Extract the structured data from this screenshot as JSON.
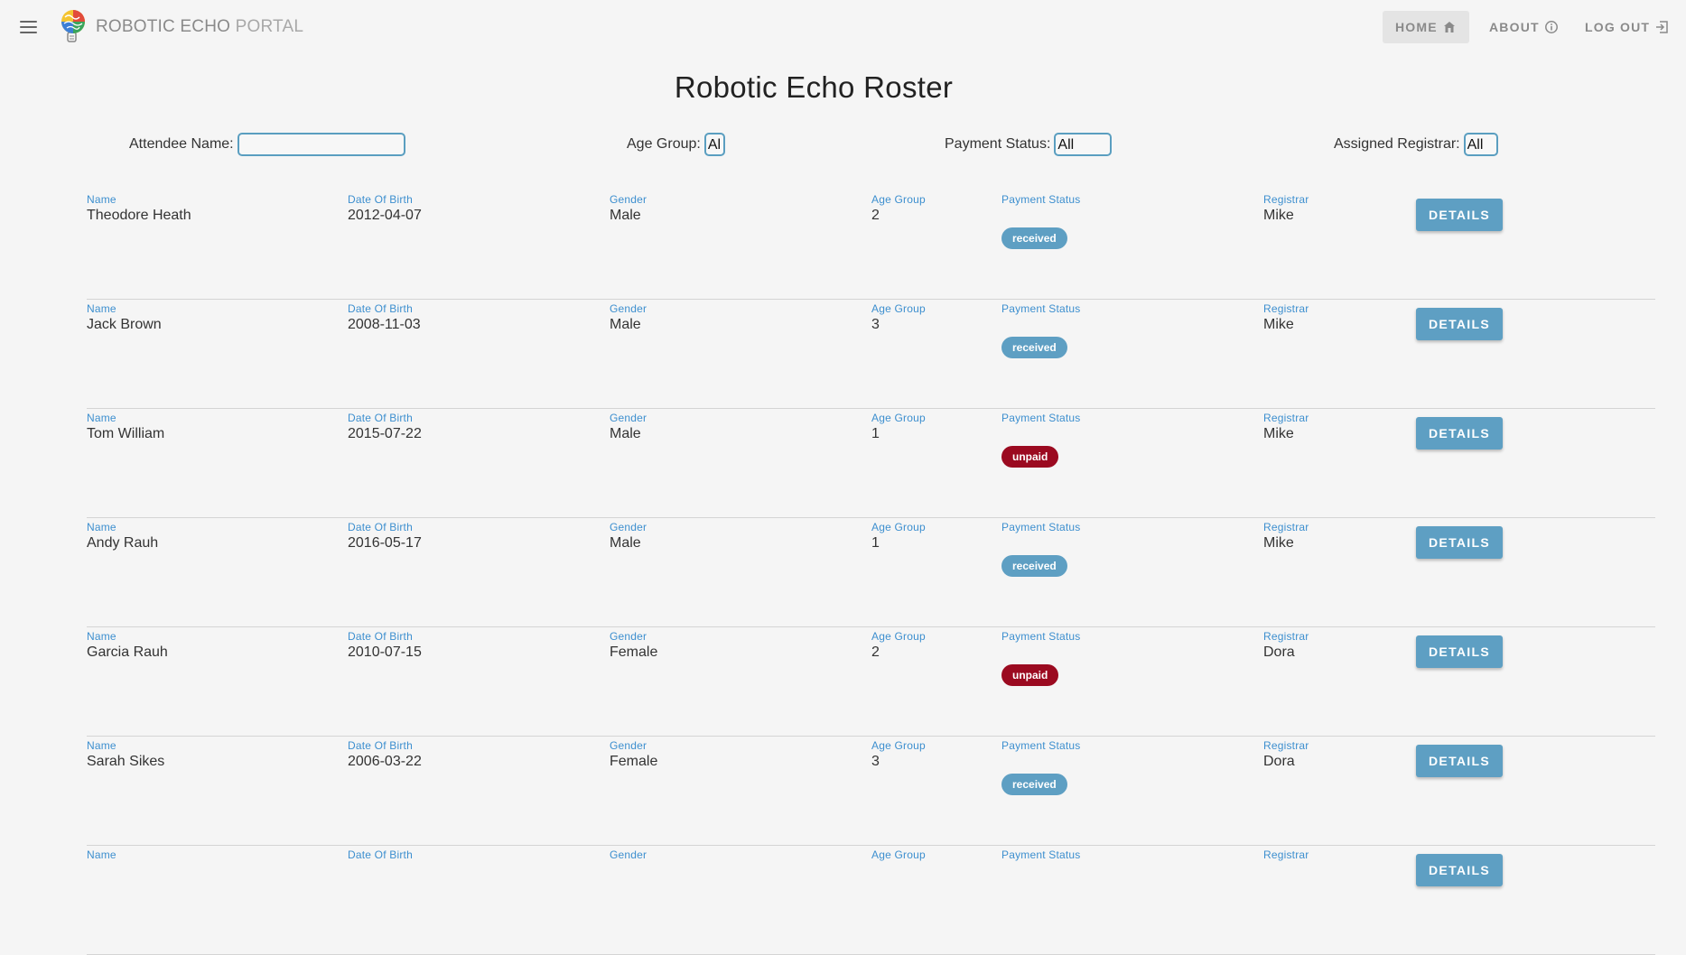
{
  "header": {
    "title_part1": "ROBOTIC ECHO",
    "title_part2": "PORTAL",
    "nav": {
      "home": "HOME",
      "about": "ABOUT",
      "logout": "LOG OUT"
    }
  },
  "page": {
    "title": "Robotic Echo Roster"
  },
  "filters": {
    "name_label": "Attendee Name:",
    "name_value": "",
    "age_label": "Age Group:",
    "age_value": "All",
    "payment_label": "Payment Status:",
    "payment_value": "All",
    "registrar_label": "Assigned Registrar:",
    "registrar_value": "All"
  },
  "columns": {
    "name": "Name",
    "dob": "Date Of Birth",
    "gender": "Gender",
    "age_group": "Age Group",
    "payment": "Payment Status",
    "registrar": "Registrar",
    "details": "DETAILS"
  },
  "rows": [
    {
      "name": "Theodore Heath",
      "dob": "2012-04-07",
      "gender": "Male",
      "age_group": "2",
      "payment": "received",
      "registrar": "Mike"
    },
    {
      "name": "Jack Brown",
      "dob": "2008-11-03",
      "gender": "Male",
      "age_group": "3",
      "payment": "received",
      "registrar": "Mike"
    },
    {
      "name": "Tom William",
      "dob": "2015-07-22",
      "gender": "Male",
      "age_group": "1",
      "payment": "unpaid",
      "registrar": "Mike"
    },
    {
      "name": "Andy Rauh",
      "dob": "2016-05-17",
      "gender": "Male",
      "age_group": "1",
      "payment": "received",
      "registrar": "Mike"
    },
    {
      "name": "Garcia Rauh",
      "dob": "2010-07-15",
      "gender": "Female",
      "age_group": "2",
      "payment": "unpaid",
      "registrar": "Dora"
    },
    {
      "name": "Sarah Sikes",
      "dob": "2006-03-22",
      "gender": "Female",
      "age_group": "3",
      "payment": "received",
      "registrar": "Dora"
    },
    {
      "name": "",
      "dob": "",
      "gender": "",
      "age_group": "",
      "payment": "",
      "registrar": ""
    }
  ],
  "colors": {
    "accent": "#5e9fc3",
    "label_blue": "#3d8fcf",
    "unpaid": "#9b0a20",
    "background": "#f5f5f5"
  },
  "icons": [
    "menu-icon",
    "brain-logo-icon",
    "home-icon",
    "info-icon",
    "logout-icon"
  ]
}
